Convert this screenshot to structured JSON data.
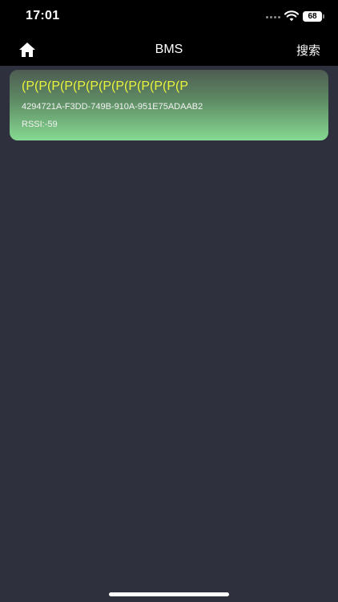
{
  "status_bar": {
    "time": "17:01",
    "battery": "68",
    "signal_icon": "cellular-signal-icon",
    "wifi_icon": "wifi-icon"
  },
  "nav": {
    "title": "BMS",
    "search_label": "搜索",
    "home_icon": "home-icon"
  },
  "devices": [
    {
      "name": "(P(P(P(P(P(P(P(P(P(P(P(P(P",
      "uuid": "4294721A-F3DD-749B-910A-951E75ADAAB2",
      "rssi": "RSSI:-59"
    }
  ],
  "colors": {
    "background": "#2e313d",
    "bar": "#000000",
    "device_name": "#e9f53a",
    "card_gradient_top": "#4e5c52",
    "card_gradient_bottom": "#86d992"
  }
}
